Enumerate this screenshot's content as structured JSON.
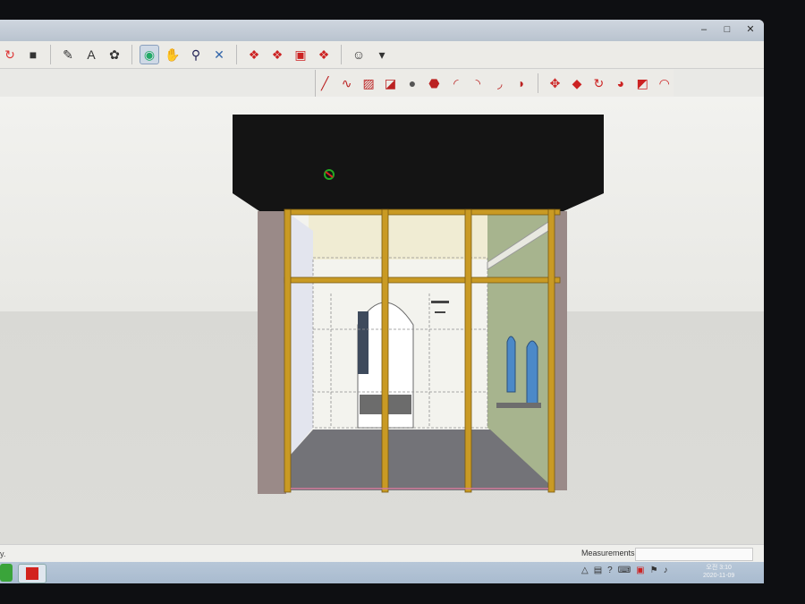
{
  "window": {
    "controls": [
      "–",
      "□",
      "✕"
    ]
  },
  "toolbar_main": {
    "items": [
      {
        "icon": "rotate-red-icon",
        "glyph": "↻",
        "color": "#d33"
      },
      {
        "icon": "push-pull-icon",
        "glyph": "■",
        "color": "#333"
      },
      {
        "icon": "tape-measure-icon",
        "glyph": "✎",
        "color": "#333"
      },
      {
        "icon": "text-tool-icon",
        "glyph": "A",
        "color": "#333"
      },
      {
        "icon": "paint-bucket-icon",
        "glyph": "✿",
        "color": "#333"
      },
      {
        "icon": "orbit-icon",
        "glyph": "◉",
        "color": "#2a6",
        "active": true
      },
      {
        "icon": "pan-hand-icon",
        "glyph": "✋",
        "color": "#a66"
      },
      {
        "icon": "zoom-icon",
        "glyph": "⚲",
        "color": "#225"
      },
      {
        "icon": "zoom-extents-icon",
        "glyph": "✕",
        "color": "#36a"
      },
      {
        "icon": "3d-warehouse-icon",
        "glyph": "❖",
        "color": "#c22"
      },
      {
        "icon": "components-icon",
        "glyph": "❖",
        "color": "#c22"
      },
      {
        "icon": "extension-warehouse-icon",
        "glyph": "▣",
        "color": "#c22"
      },
      {
        "icon": "layout-icon",
        "glyph": "❖",
        "color": "#c22"
      },
      {
        "icon": "user-account-icon",
        "glyph": "☺",
        "color": "#333"
      },
      {
        "icon": "chevron-down-icon",
        "glyph": "▾",
        "color": "#333"
      }
    ]
  },
  "toolbar_draw": {
    "items": [
      {
        "icon": "line-icon",
        "glyph": "╱",
        "color": "#b22"
      },
      {
        "icon": "freehand-icon",
        "glyph": "∿",
        "color": "#b22"
      },
      {
        "icon": "rectangle-icon",
        "glyph": "▨",
        "color": "#b22"
      },
      {
        "icon": "rotated-rectangle-icon",
        "glyph": "◪",
        "color": "#b22"
      },
      {
        "icon": "circle-icon",
        "glyph": "●",
        "color": "#555"
      },
      {
        "icon": "polygon-icon",
        "glyph": "⬣",
        "color": "#b22"
      },
      {
        "icon": "arc-icon",
        "glyph": "◜",
        "color": "#b22"
      },
      {
        "icon": "2point-arc-icon",
        "glyph": "◝",
        "color": "#b22"
      },
      {
        "icon": "3point-arc-icon",
        "glyph": "◞",
        "color": "#b22"
      },
      {
        "icon": "pie-icon",
        "glyph": "◗",
        "color": "#b22"
      },
      {
        "icon": "move-icon",
        "glyph": "✥",
        "color": "#c22"
      },
      {
        "icon": "push-pull-icon",
        "glyph": "◆",
        "color": "#c22"
      },
      {
        "icon": "rotate-icon",
        "glyph": "↻",
        "color": "#c22"
      },
      {
        "icon": "follow-me-icon",
        "glyph": "◕",
        "color": "#c22"
      },
      {
        "icon": "scale-icon",
        "glyph": "◩",
        "color": "#c22"
      },
      {
        "icon": "offset-icon",
        "glyph": "◠",
        "color": "#c22"
      }
    ]
  },
  "status": {
    "left_text": "y.",
    "measurements_label": "Measurements"
  },
  "clock": {
    "time": "오전 3:10",
    "date": "2020-11-09"
  }
}
